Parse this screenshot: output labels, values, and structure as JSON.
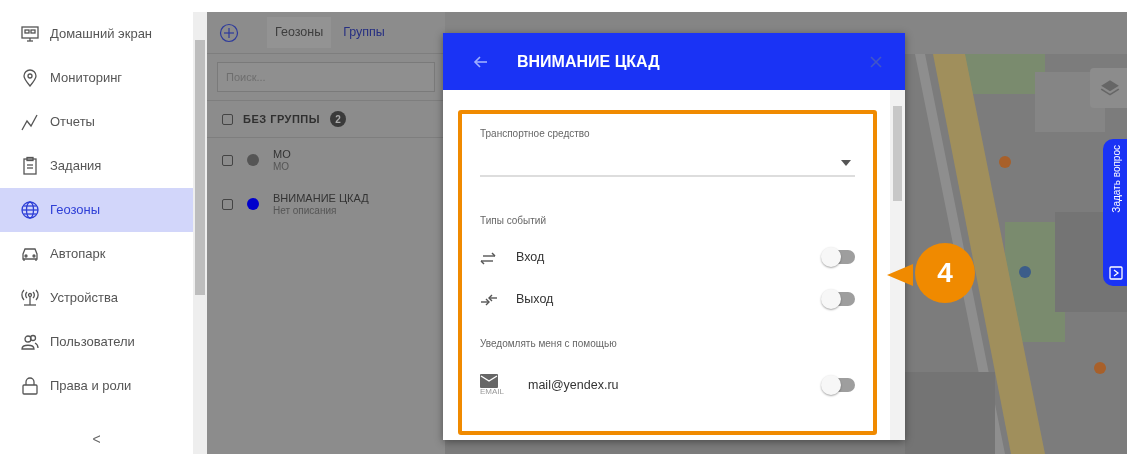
{
  "sidebar": {
    "items": [
      {
        "label": "Домашний экран",
        "selected": false
      },
      {
        "label": "Мониторинг",
        "selected": false
      },
      {
        "label": "Отчеты",
        "selected": false
      },
      {
        "label": "Задания",
        "selected": false
      },
      {
        "label": "Геозоны",
        "selected": true
      },
      {
        "label": "Автопарк",
        "selected": false
      },
      {
        "label": "Устройства",
        "selected": false
      },
      {
        "label": "Пользователи",
        "selected": false
      },
      {
        "label": "Права и роли",
        "selected": false
      }
    ],
    "collapse_button": "<"
  },
  "geozones_panel": {
    "tabs": [
      {
        "label": "Геозоны",
        "selected": false
      },
      {
        "label": "Группы",
        "selected": true
      }
    ],
    "search": {
      "placeholder": "Поиск..."
    },
    "group": {
      "title": "БЕЗ ГРУППЫ",
      "count": "2",
      "checked": false
    },
    "items": [
      {
        "name": "МО",
        "description": "МО",
        "color": "#555555",
        "checked": false
      },
      {
        "name": "ВНИМАНИЕ ЦКАД",
        "description": "Нет описания",
        "color": "#0000cc",
        "checked": false
      }
    ]
  },
  "dialog": {
    "title": "ВНИМАНИЕ ЦКАД",
    "vehicle_field": {
      "label": "Транспортное средство"
    },
    "event_types_heading": "Типы событий",
    "events": [
      {
        "label": "Вход",
        "kind": "enter",
        "on": false
      },
      {
        "label": "Выход",
        "kind": "exit",
        "on": false
      }
    ],
    "notify_heading": "Уведомлять меня с помощью",
    "channels": [
      {
        "type_label": "EMAIL",
        "address": "mail@yendex.ru",
        "on": false
      }
    ]
  },
  "annotation": {
    "number": "4"
  },
  "help_button": {
    "label": "Задать вопрос"
  }
}
